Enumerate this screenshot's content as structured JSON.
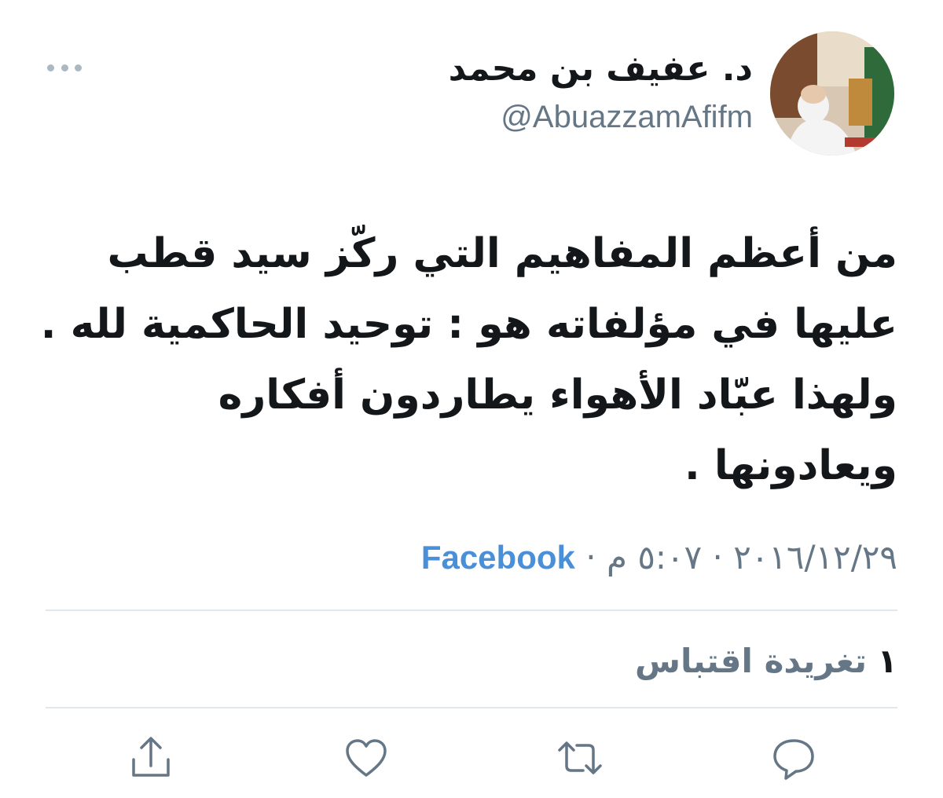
{
  "user": {
    "display_name": "د. عفيف بن محمد",
    "handle": "@AbuazzamAfifm",
    "avatar_icon": "profile-photo"
  },
  "tweet": {
    "lines": [
      "من أعظم المفاهيم التي ركّز سيد قطب",
      "عليها في مؤلفاته هو : توحيد الحاكمية لله .",
      "ولهذا عبّاد الأهواء يطاردون أفكاره",
      "ويعادونها ."
    ]
  },
  "meta": {
    "date": "٢٠١٦/١٢/٢٩",
    "separator": "·",
    "time": "٥:٠٧ م",
    "source": "Facebook"
  },
  "quotes": {
    "count": "١",
    "label": "تغريدة اقتباس"
  },
  "actions": {
    "reply_icon": "reply-icon",
    "retweet_icon": "retweet-icon",
    "like_icon": "heart-icon",
    "share_icon": "share-icon"
  },
  "colors": {
    "link": "#4a90d9",
    "muted": "#657786",
    "icon": "#657786",
    "divider": "#e1e8ed"
  }
}
